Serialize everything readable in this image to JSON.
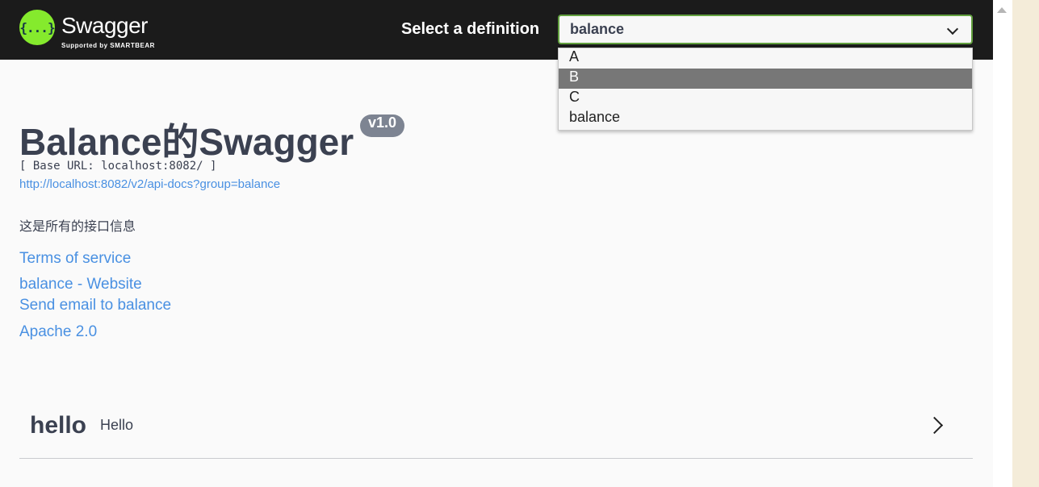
{
  "header": {
    "logo_glyph": "{...}",
    "brand": "Swagger",
    "brand_tagline": "Supported by SMARTBEAR",
    "select_label": "Select a definition",
    "selected_value": "balance",
    "accent_color": "#85ea2d"
  },
  "dropdown": {
    "options": [
      "A",
      "B",
      "C",
      "balance"
    ],
    "highlighted": "B"
  },
  "info": {
    "title": "Balance的Swagger",
    "version": "v1.0",
    "base_url": "[ Base URL: localhost:8082/ ]",
    "api_docs_url": "http://localhost:8082/v2/api-docs?group=balance",
    "description": "这是所有的接口信息",
    "terms": "Terms of service",
    "website": "balance - Website",
    "email": "Send email to balance",
    "license": "Apache 2.0"
  },
  "tags": [
    {
      "name": "hello",
      "description": "Hello",
      "icon": "chevron-right-icon"
    }
  ]
}
